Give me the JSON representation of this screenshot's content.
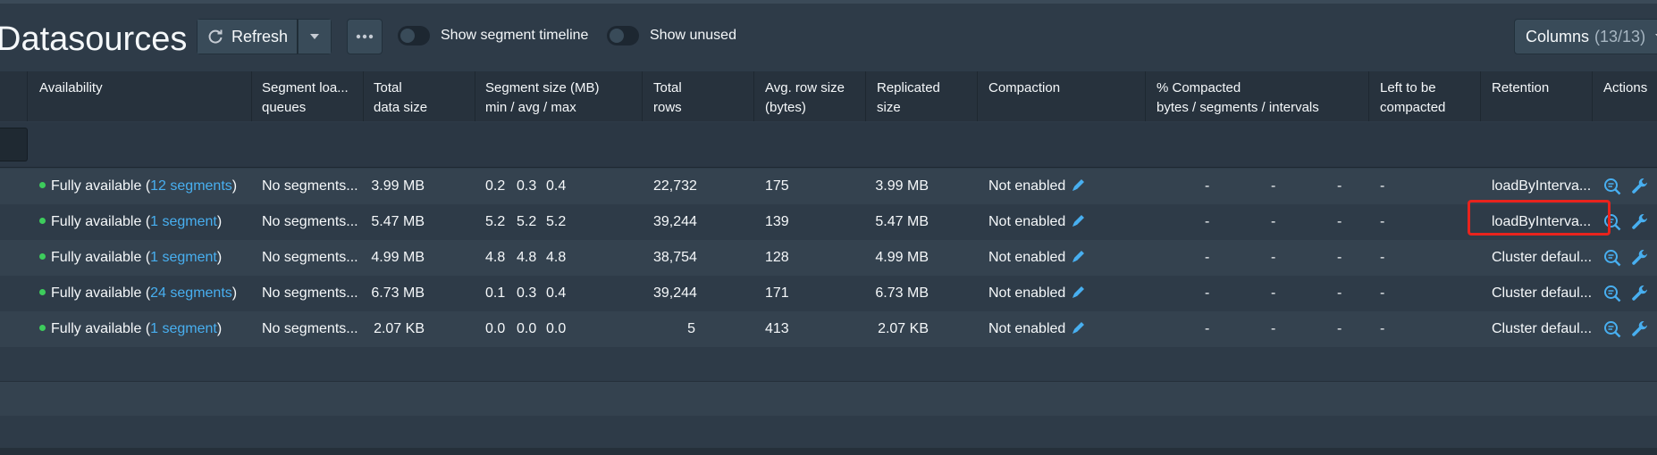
{
  "page": {
    "title": "Datasources"
  },
  "toolbar": {
    "refresh_label": "Refresh",
    "show_segment_timeline_label": "Show segment timeline",
    "show_unused_label": "Show unused",
    "columns_label": "Columns",
    "columns_count": "(13/13)"
  },
  "table": {
    "headers": {
      "availability": "Availability",
      "segment_load_queues_1": "Segment loa...",
      "segment_load_queues_2": "queues",
      "total_data_size_1": "Total",
      "total_data_size_2": "data size",
      "segment_size_1": "Segment size (MB)",
      "segment_size_2": "min / avg / max",
      "total_rows_1": "Total",
      "total_rows_2": "rows",
      "avg_row_size_1": "Avg. row size",
      "avg_row_size_2": "(bytes)",
      "replicated_size_1": "Replicated",
      "replicated_size_2": "size",
      "compaction": "Compaction",
      "pct_compacted_1": "% Compacted",
      "pct_compacted_2": "bytes / segments / intervals",
      "left_to_be_compacted_1": "Left to be",
      "left_to_be_compacted_2": "compacted",
      "retention": "Retention",
      "actions": "Actions"
    },
    "rows": [
      {
        "availability_prefix": "Fully available (",
        "availability_link": "12 segments",
        "availability_suffix": ")",
        "segment_load_queues": "No segments...",
        "total_data_size": "3.99 MB",
        "seg_min": "0.2",
        "seg_avg": "0.3",
        "seg_max": "0.4",
        "total_rows": "22,732",
        "avg_row_size": "175",
        "replicated_size": "3.99 MB",
        "compaction": "Not enabled",
        "pct_bytes": "-",
        "pct_segments": "-",
        "pct_intervals": "-",
        "left_to_be_compacted": "-",
        "retention": "loadByInterva..."
      },
      {
        "availability_prefix": "Fully available (",
        "availability_link": "1 segment",
        "availability_suffix": ")",
        "segment_load_queues": "No segments...",
        "total_data_size": "5.47 MB",
        "seg_min": "5.2",
        "seg_avg": "5.2",
        "seg_max": "5.2",
        "total_rows": "39,244",
        "avg_row_size": "139",
        "replicated_size": "5.47 MB",
        "compaction": "Not enabled",
        "pct_bytes": "-",
        "pct_segments": "-",
        "pct_intervals": "-",
        "left_to_be_compacted": "-",
        "retention": "loadByInterva..."
      },
      {
        "availability_prefix": "Fully available (",
        "availability_link": "1 segment",
        "availability_suffix": ")",
        "segment_load_queues": "No segments...",
        "total_data_size": "4.99 MB",
        "seg_min": "4.8",
        "seg_avg": "4.8",
        "seg_max": "4.8",
        "total_rows": "38,754",
        "avg_row_size": "128",
        "replicated_size": "4.99 MB",
        "compaction": "Not enabled",
        "pct_bytes": "-",
        "pct_segments": "-",
        "pct_intervals": "-",
        "left_to_be_compacted": "-",
        "retention": "Cluster defaul..."
      },
      {
        "availability_prefix": "Fully available (",
        "availability_link": "24 segments",
        "availability_suffix": ")",
        "segment_load_queues": "No segments...",
        "total_data_size": "6.73 MB",
        "seg_min": "0.1",
        "seg_avg": "0.3",
        "seg_max": "0.4",
        "total_rows": "39,244",
        "avg_row_size": "171",
        "replicated_size": "6.73 MB",
        "compaction": "Not enabled",
        "pct_bytes": "-",
        "pct_segments": "-",
        "pct_intervals": "-",
        "left_to_be_compacted": "-",
        "retention": "Cluster defaul..."
      },
      {
        "availability_prefix": "Fully available (",
        "availability_link": "1 segment",
        "availability_suffix": ")",
        "segment_load_queues": "No segments...",
        "total_data_size": "2.07 KB",
        "seg_min": "0.0",
        "seg_avg": "0.0",
        "seg_max": "0.0",
        "total_rows": "5",
        "avg_row_size": "413",
        "replicated_size": "2.07 KB",
        "compaction": "Not enabled",
        "pct_bytes": "-",
        "pct_segments": "-",
        "pct_intervals": "-",
        "left_to_be_compacted": "-",
        "retention": "Cluster defaul..."
      }
    ]
  },
  "icons": {
    "refresh": "refresh-icon",
    "caret": "caret-down-icon",
    "more": "more-icon",
    "edit": "edit-icon",
    "search": "search-icon",
    "wrench": "wrench-icon"
  },
  "colors": {
    "link": "#48aff0",
    "available_dot": "#3dcc5c",
    "highlight": "#e8231d"
  }
}
